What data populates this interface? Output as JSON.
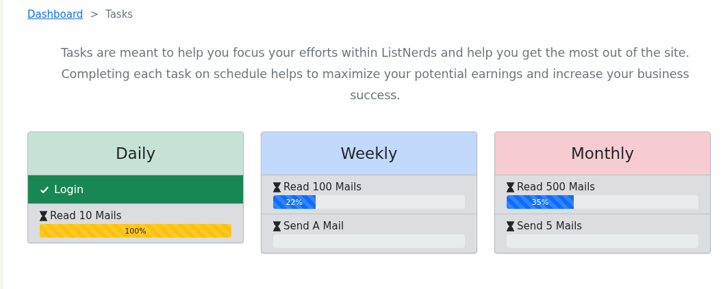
{
  "breadcrumb": {
    "link": "Dashboard",
    "separator": ">",
    "current": "Tasks"
  },
  "intro": "Tasks are meant to help you focus your efforts within ListNerds and help you get the most out of the site. Completing each task on schedule helps to maximize your potential earnings and increase your business success.",
  "columns": [
    {
      "title": "Daily",
      "color": "#c6e2d6",
      "tasks": [
        {
          "kind": "done",
          "label": "Login"
        },
        {
          "kind": "progress",
          "label": "Read 10 Mails",
          "level": 1,
          "reading": "100%",
          "color": "#ffc107"
        }
      ]
    },
    {
      "title": "Weekly",
      "color": "#c2d9fc",
      "tasks": [
        {
          "kind": "progress",
          "label": "Read 100 Mails",
          "level": 0.22,
          "reading": "22%",
          "color": "#0d6efd"
        },
        {
          "kind": "progress",
          "label": "Send A Mail"
        }
      ]
    },
    {
      "title": "Monthly",
      "color": "#f6ccd2",
      "tasks": [
        {
          "kind": "progress",
          "label": "Read 500 Mails",
          "level": 0.35,
          "reading": "35%",
          "color": "#0d6efd"
        },
        {
          "kind": "progress",
          "label": "Send 5 Mails"
        }
      ]
    }
  ]
}
